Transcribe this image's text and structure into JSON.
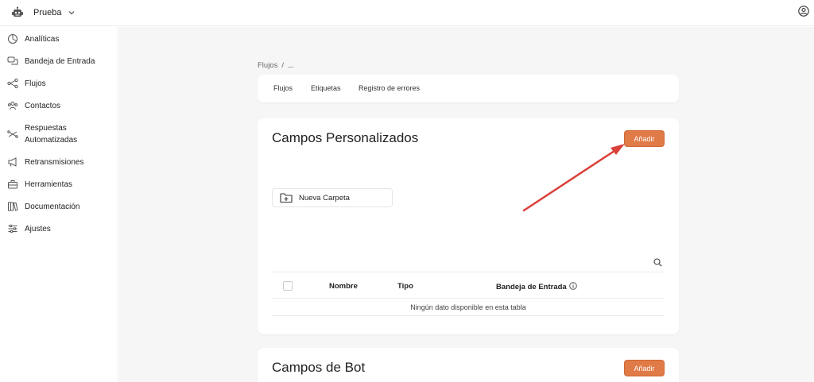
{
  "topbar": {
    "workspace_name": "Prueba",
    "workspace_icon": "robot-icon",
    "dropdown_icon": "chevron-down-icon",
    "user_icon": "user-circle-icon"
  },
  "sidebar": {
    "items": [
      {
        "label": "Analíticas",
        "icon": "chart-pie-icon"
      },
      {
        "label": "Bandeja de Entrada",
        "icon": "chat-bubbles-icon"
      },
      {
        "label": "Flujos",
        "icon": "flow-icon"
      },
      {
        "label": "Contactos",
        "icon": "contacts-icon"
      },
      {
        "label": "Respuestas\nAutomatizadas",
        "icon": "automation-icon"
      },
      {
        "label": "Retransmisiones",
        "icon": "megaphone-icon"
      },
      {
        "label": "Herramientas",
        "icon": "toolbox-icon"
      },
      {
        "label": "Documentación",
        "icon": "books-icon"
      },
      {
        "label": "Ajustes",
        "icon": "sliders-icon"
      }
    ]
  },
  "breadcrumb": {
    "root": "Flujos",
    "separator": "/",
    "current": "..."
  },
  "tabs": {
    "items": [
      {
        "label": "Flujos"
      },
      {
        "label": "Etiquetas"
      },
      {
        "label": "Registro de errores"
      }
    ]
  },
  "custom_fields": {
    "title": "Campos Personalizados",
    "add_label": "Añadir",
    "new_folder_label": "Nueva Carpeta",
    "search_icon": "search-icon",
    "table": {
      "columns": [
        "Nombre",
        "Tipo",
        "Bandeja de Entrada"
      ],
      "empty_message": "Ningún dato disponible en esta tabla"
    }
  },
  "bot_fields": {
    "title": "Campos de Bot",
    "add_label": "Añadir"
  },
  "colors": {
    "accent": "#e07a46",
    "annotation_arrow": "#d9413a",
    "background": "#f6f6f6"
  }
}
